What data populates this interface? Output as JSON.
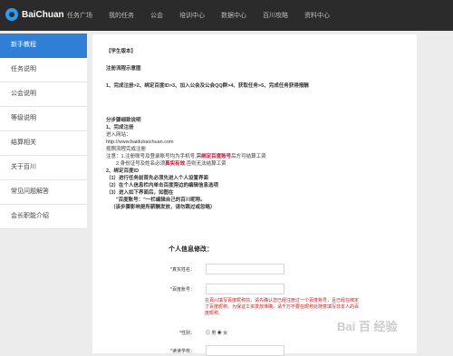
{
  "topbar": {
    "logo_text": "BaiChuan",
    "nav": [
      "任务广场",
      "我的任务",
      "公会",
      "培训中心",
      "数据中心",
      "百川攻略",
      "资料中心"
    ]
  },
  "sidebar": {
    "items": [
      {
        "label": "新手教程",
        "active": true
      },
      {
        "label": "任务说明"
      },
      {
        "label": "公会说明"
      },
      {
        "label": "等级说明"
      },
      {
        "label": "结算相关"
      },
      {
        "label": "关于百川"
      },
      {
        "label": "常见问题解答"
      },
      {
        "label": "会长职能介绍"
      }
    ]
  },
  "content": {
    "version": "【学生版本】",
    "flow_title": "注册流程示意图",
    "flow_steps": "1、完成注册>2、绑定百度ID>3、加入公会及公会QQ群>4、获取任务>5、完成任务获得报酬",
    "step_title": "分步骤细致说明",
    "s1_title": "1、完成注册",
    "s1_enter": "进入网站：",
    "s1_url": "http://www.baidubaichuan.com",
    "s1_follow": "按照流程完成注册",
    "note1_a": "注意：1.注册账号及登录账号均为手机号,需",
    "note1_red": "绑定百度账号",
    "note1_b": "后方可结算工资",
    "note2_a": "2.身份证号及姓名必须",
    "note2_red": "真实有效",
    "note2_b": ",否则无法结算工资",
    "s2_title": "2、绑定百度ID",
    "s2_1": "（1）进行任务前首先必须先进入个人设置界面",
    "s2_2": "（2）在个人信息栏内单击百度旁边的编辑信息选项",
    "s2_3": "（3）进入如下界面后，如图在",
    "s2_4": "\"百度账号：\"一栏编辑自己的百川昵称。",
    "s2_5": "（该步骤影响是所薪酬发放，请勿跳过或忽略）"
  },
  "form": {
    "title": "个人信息修改：",
    "real_name_label": "*真实姓名：",
    "baidu_label": "*百度账号：",
    "note": "在百川填写百度昵称前，请先确认您已经注册过一个百度账号，且已经在绑定了百度昵称。为保证工资发放准确，请千万不要在昵称处随意填写非本人的百度昵称。",
    "gender_label": "*性别：",
    "gender_options": "◎ 男 ◉ 女",
    "school_label": "*读读学校："
  },
  "watermark": "Bai 百 经验",
  "colors": {
    "accent": "#2f7fd6",
    "topbar": "#2b2b2b",
    "red": "#c8102e"
  }
}
